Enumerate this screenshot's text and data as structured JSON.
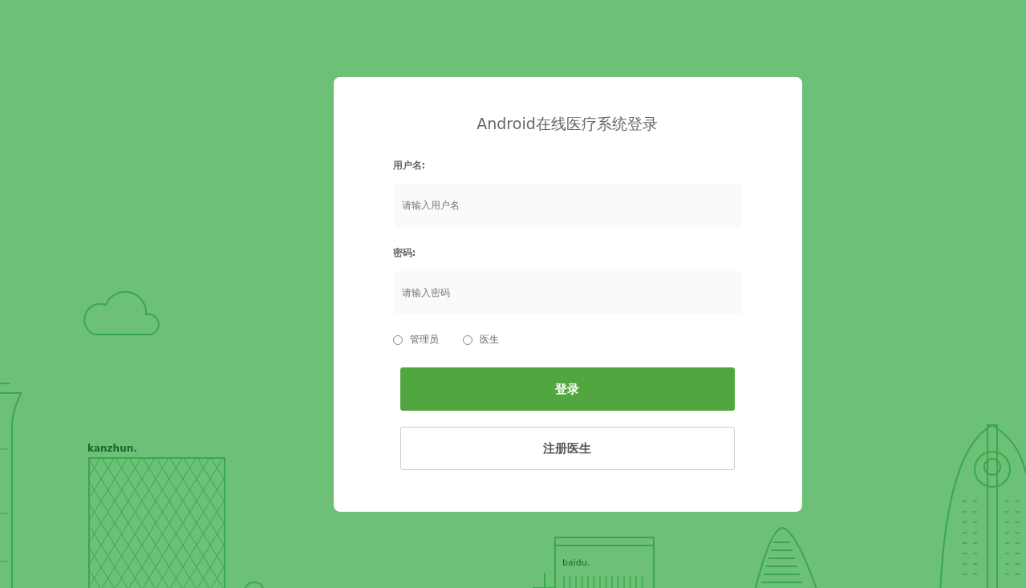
{
  "login": {
    "title": "Android在线医疗系统登录",
    "fields": [
      {
        "label": "用户名:",
        "placeholder": "请输入用户名"
      },
      {
        "label": "密码:",
        "placeholder": "请输入密码"
      }
    ],
    "roles": [
      {
        "label": "管理员",
        "selected": false
      },
      {
        "label": "医生",
        "selected": false
      }
    ],
    "buttons": [
      {
        "label": "登录",
        "kind": "primary"
      },
      {
        "label": "注册医生",
        "kind": "secondary"
      }
    ]
  },
  "background": {
    "labels": [
      "kanzhun.",
      "baidu."
    ]
  }
}
